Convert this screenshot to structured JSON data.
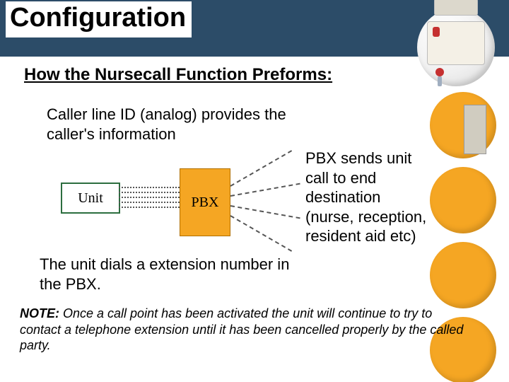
{
  "title": "Configuration",
  "subtitle": "How the Nursecall Function Preforms:",
  "caller_id_text": "Caller line ID (analog) provides the caller's information",
  "pbx_dest_text": "PBX sends unit call to end destination (nurse, reception, resident aid etc)",
  "dial_text": "The unit dials a extension number in the PBX.",
  "note_label": "NOTE:",
  "note_body": "  Once a call point has been activated the unit will continue to try to contact a telephone extension until it has been cancelled properly by the called party.",
  "boxes": {
    "unit": "Unit",
    "pbx": "PBX"
  },
  "colors": {
    "title_bg": "#2c4c68",
    "pbx_box": "#f5a623",
    "unit_border": "#2c6e3f",
    "circle": "#f5a623"
  }
}
